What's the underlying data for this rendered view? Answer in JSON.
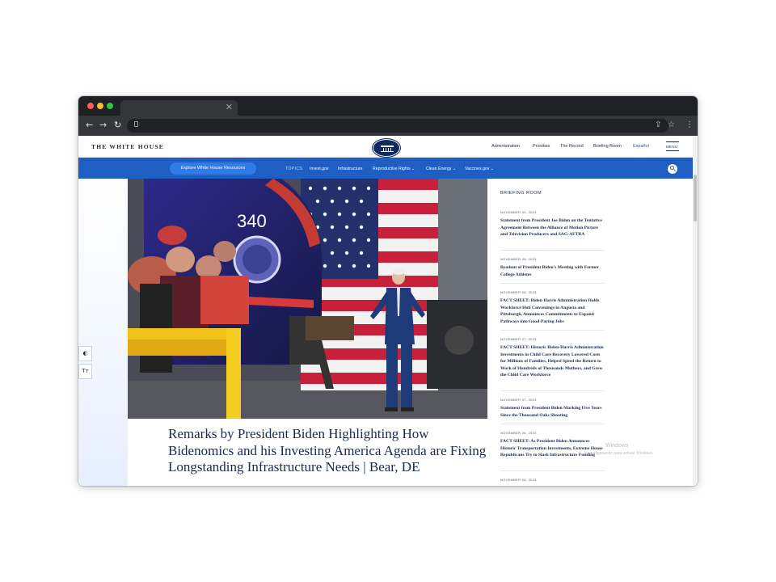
{
  "site": {
    "name": "THE WHITE HOUSE",
    "nav": [
      "Administration",
      "Priorities",
      "The Record",
      "Briefing Room",
      "Español"
    ],
    "menu_label": "MENU"
  },
  "topics_bar": {
    "explore_label": "Explore White House Resources",
    "topics_label": "TOPICS:",
    "topics": [
      "Invest.gov",
      "Infrastructure",
      "Reproductive Rights",
      "Clean Energy",
      "Vaccines.gov"
    ]
  },
  "hero": {
    "train_number": "340",
    "headline": "Remarks by President Biden Highlighting How Bidenomics and his Investing America Agenda are Fixing Longstanding Infrastructure Needs | Bear, DE"
  },
  "briefing_room": {
    "title": "BRIEFING ROOM",
    "items": [
      {
        "date": "NOVEMBER 09, 2023",
        "text": "Statement from President Joe Biden on the Tentative Agreement Between the Alliance of Motion Picture and Television Producers and SAG-AFTRA"
      },
      {
        "date": "NOVEMBER 08, 2023",
        "text": "Readout of President Biden's Meeting with Former College Athletes"
      },
      {
        "date": "NOVEMBER 08, 2023",
        "text": "FACT SHEET: Biden-Harris Administration Holds Workforce Hub Convenings in Augusta and Pittsburgh, Announces Commitments to Expand Pathways into Good-Paying Jobs"
      },
      {
        "date": "NOVEMBER 07, 2023",
        "text": "FACT SHEET: Historic Biden-Harris Administration Investments in Child Care Recovery Lowered Costs for Millions of Families, Helped Speed the Return to Work of Hundreds of Thousands Mothers, and Grew the Child Care Workforce"
      },
      {
        "date": "NOVEMBER 07, 2023",
        "text": "Statement from President Biden Marking Five Years Since the Thousand Oaks Shooting"
      },
      {
        "date": "NOVEMBER 06, 2023",
        "text": "FACT SHEET: As President Biden Announces Historic Transportation Investments, Extreme House Republicans Try to Slash Infrastructure Funding"
      },
      {
        "date": "NOVEMBER 06, 2023",
        "text": ""
      }
    ]
  },
  "watermark": {
    "line1": "Windows",
    "line2": "la configuración para activar Windows."
  },
  "colors": {
    "navy": "#1b2a4a",
    "topics_blue": "#1f5fc4",
    "explore_blue": "#2f7bea"
  }
}
